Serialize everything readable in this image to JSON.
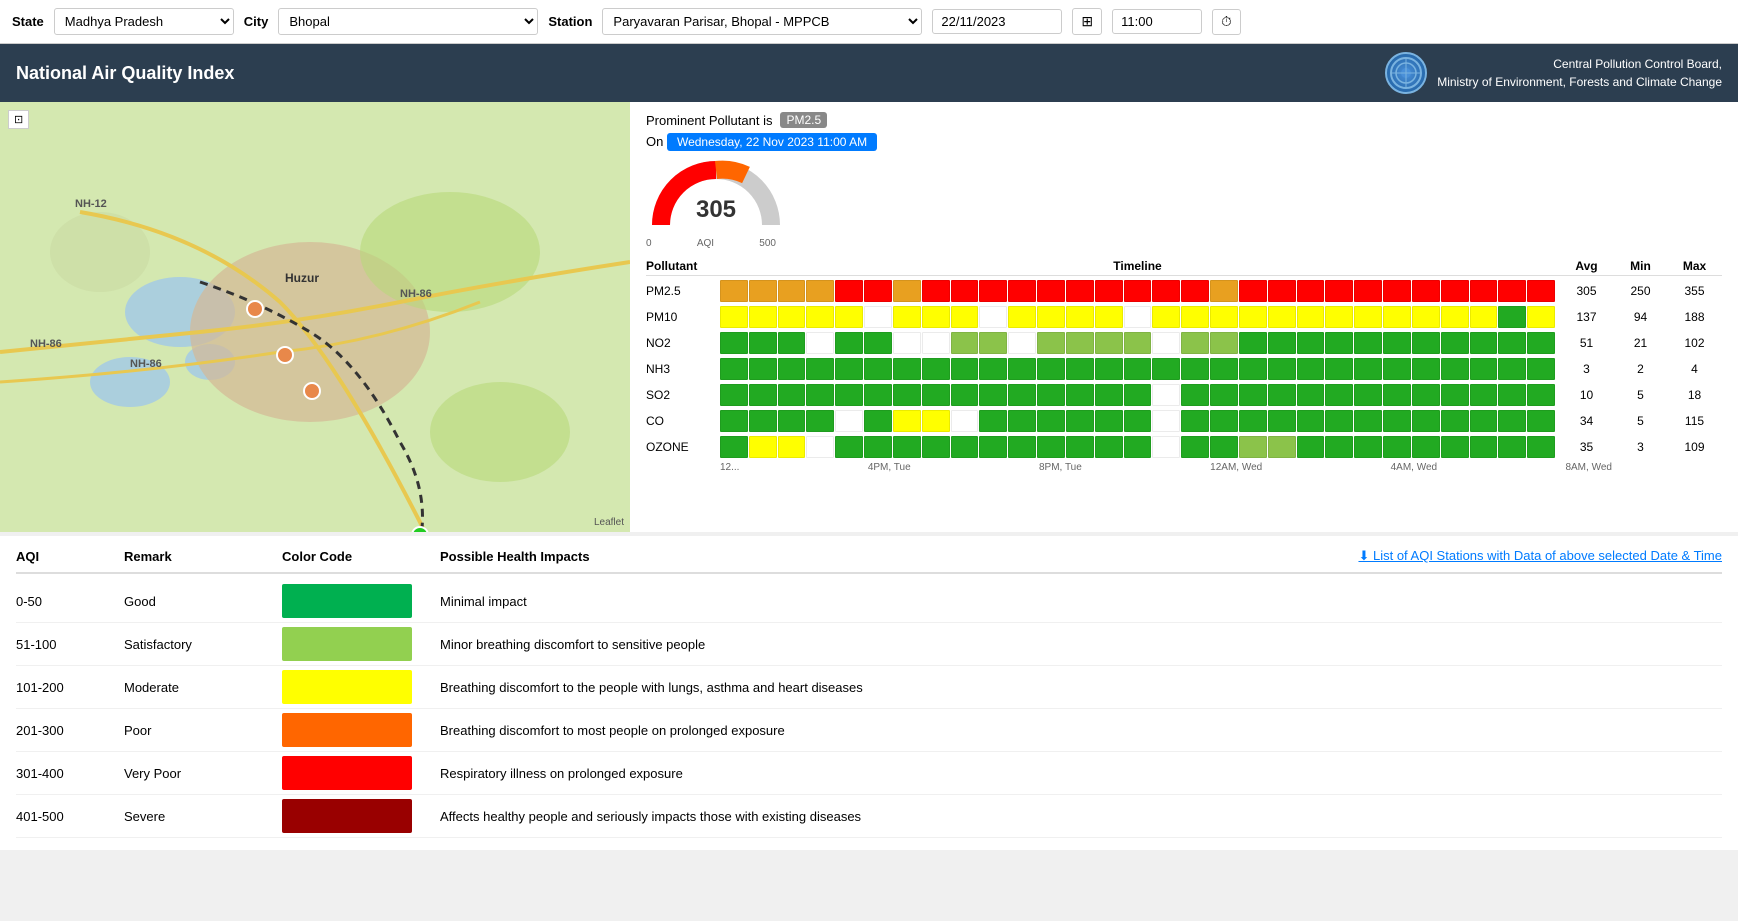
{
  "topbar": {
    "state_label": "State",
    "city_label": "City",
    "station_label": "Station",
    "state_value": "Madhya Pradesh",
    "city_value": "Bhopal",
    "station_value": "Paryavaran Parisar, Bhopal - MPPCB",
    "date_value": "22/11/2023",
    "time_value": "11:00",
    "grid_icon": "⊞",
    "clock_icon": "⏱"
  },
  "header": {
    "title": "National Air Quality Index",
    "org_line1": "Central Pollution Control Board,",
    "org_line2": "Ministry of Environment, Forests and Climate Change"
  },
  "aqi_panel": {
    "prominent_label": "Prominent Pollutant is",
    "pm25_badge": "PM2.5",
    "date_badge": "Wednesday, 22 Nov 2023 11:00 AM",
    "aqi_value": "305",
    "aqi_sublabel": "AQI",
    "gauge_min": "0",
    "gauge_mid": "500"
  },
  "pollutants": {
    "header": {
      "pollutant": "Pollutant",
      "timeline": "Timeline",
      "avg": "Avg",
      "min": "Min",
      "max": "Max"
    },
    "rows": [
      {
        "name": "PM2.5",
        "avg": "305",
        "min": "250",
        "max": "355",
        "colors": [
          "#e8a020",
          "#e8a020",
          "#e8a020",
          "#e8a020",
          "#ff0000",
          "#ff0000",
          "#e8a020",
          "#ff0000",
          "#ff0000",
          "#ff0000",
          "#ff0000",
          "#ff0000",
          "#ff0000",
          "#ff0000",
          "#ff0000",
          "#ff0000",
          "#ff0000",
          "#e8a020",
          "#ff0000",
          "#ff0000",
          "#ff0000",
          "#ff0000",
          "#ff0000",
          "#ff0000",
          "#ff0000",
          "#ff0000",
          "#ff0000",
          "#ff0000",
          "#ff0000"
        ]
      },
      {
        "name": "PM10",
        "avg": "137",
        "min": "94",
        "max": "188",
        "colors": [
          "#ffff00",
          "#ffff00",
          "#ffff00",
          "#ffff00",
          "#ffff00",
          "#ffffff",
          "#ffff00",
          "#ffff00",
          "#ffff00",
          "#ffffff",
          "#ffff00",
          "#ffff00",
          "#ffff00",
          "#ffff00",
          "#ffffff",
          "#ffff00",
          "#ffff00",
          "#ffff00",
          "#ffff00",
          "#ffff00",
          "#ffff00",
          "#ffff00",
          "#ffff00",
          "#ffff00",
          "#ffff00",
          "#ffff00",
          "#ffff00",
          "#22aa22",
          "#ffff00"
        ]
      },
      {
        "name": "NO2",
        "avg": "51",
        "min": "21",
        "max": "102",
        "colors": [
          "#22aa22",
          "#22aa22",
          "#22aa22",
          "#ffffff",
          "#22aa22",
          "#22aa22",
          "#ffffff",
          "#ffffff",
          "#8bc34a",
          "#8bc34a",
          "#ffffff",
          "#8bc34a",
          "#8bc34a",
          "#8bc34a",
          "#8bc34a",
          "#ffffff",
          "#8bc34a",
          "#8bc34a",
          "#22aa22",
          "#22aa22",
          "#22aa22",
          "#22aa22",
          "#22aa22",
          "#22aa22",
          "#22aa22",
          "#22aa22",
          "#22aa22",
          "#22aa22",
          "#22aa22"
        ]
      },
      {
        "name": "NH3",
        "avg": "3",
        "min": "2",
        "max": "4",
        "colors": [
          "#22aa22",
          "#22aa22",
          "#22aa22",
          "#22aa22",
          "#22aa22",
          "#22aa22",
          "#22aa22",
          "#22aa22",
          "#22aa22",
          "#22aa22",
          "#22aa22",
          "#22aa22",
          "#22aa22",
          "#22aa22",
          "#22aa22",
          "#22aa22",
          "#22aa22",
          "#22aa22",
          "#22aa22",
          "#22aa22",
          "#22aa22",
          "#22aa22",
          "#22aa22",
          "#22aa22",
          "#22aa22",
          "#22aa22",
          "#22aa22",
          "#22aa22",
          "#22aa22"
        ]
      },
      {
        "name": "SO2",
        "avg": "10",
        "min": "5",
        "max": "18",
        "colors": [
          "#22aa22",
          "#22aa22",
          "#22aa22",
          "#22aa22",
          "#22aa22",
          "#22aa22",
          "#22aa22",
          "#22aa22",
          "#22aa22",
          "#22aa22",
          "#22aa22",
          "#22aa22",
          "#22aa22",
          "#22aa22",
          "#22aa22",
          "#ffffff",
          "#22aa22",
          "#22aa22",
          "#22aa22",
          "#22aa22",
          "#22aa22",
          "#22aa22",
          "#22aa22",
          "#22aa22",
          "#22aa22",
          "#22aa22",
          "#22aa22",
          "#22aa22",
          "#22aa22"
        ]
      },
      {
        "name": "CO",
        "avg": "34",
        "min": "5",
        "max": "115",
        "colors": [
          "#22aa22",
          "#22aa22",
          "#22aa22",
          "#22aa22",
          "#ffffff",
          "#22aa22",
          "#ffff00",
          "#ffff00",
          "#ffffff",
          "#22aa22",
          "#22aa22",
          "#22aa22",
          "#22aa22",
          "#22aa22",
          "#22aa22",
          "#ffffff",
          "#22aa22",
          "#22aa22",
          "#22aa22",
          "#22aa22",
          "#22aa22",
          "#22aa22",
          "#22aa22",
          "#22aa22",
          "#22aa22",
          "#22aa22",
          "#22aa22",
          "#22aa22",
          "#22aa22"
        ]
      },
      {
        "name": "OZONE",
        "avg": "35",
        "min": "3",
        "max": "109",
        "colors": [
          "#22aa22",
          "#ffff00",
          "#ffff00",
          "#ffffff",
          "#22aa22",
          "#22aa22",
          "#22aa22",
          "#22aa22",
          "#22aa22",
          "#22aa22",
          "#22aa22",
          "#22aa22",
          "#22aa22",
          "#22aa22",
          "#22aa22",
          "#ffffff",
          "#22aa22",
          "#22aa22",
          "#8bc34a",
          "#8bc34a",
          "#22aa22",
          "#22aa22",
          "#22aa22",
          "#22aa22",
          "#22aa22",
          "#22aa22",
          "#22aa22",
          "#22aa22",
          "#22aa22"
        ]
      }
    ],
    "time_labels": [
      "12...",
      "4PM, Tue",
      "8PM, Tue",
      "12AM, Wed",
      "4AM, Wed",
      "8AM, Wed"
    ]
  },
  "legend": {
    "headers": [
      "AQI",
      "Remark",
      "Color Code",
      "Possible Health Impacts"
    ],
    "download_link": "⬇ List of AQI Stations with Data of above selected Date & Time",
    "rows": [
      {
        "aqi": "0-50",
        "remark": "Good",
        "color": "#00b050",
        "impact": "Minimal impact"
      },
      {
        "aqi": "51-100",
        "remark": "Satisfactory",
        "color": "#92d050",
        "impact": "Minor breathing discomfort to sensitive people"
      },
      {
        "aqi": "101-200",
        "remark": "Moderate",
        "color": "#ffff00",
        "impact": "Breathing discomfort to the people with lungs, asthma and heart diseases"
      },
      {
        "aqi": "201-300",
        "remark": "Poor",
        "color": "#ff6600",
        "impact": "Breathing discomfort to most people on prolonged exposure"
      },
      {
        "aqi": "301-400",
        "remark": "Very Poor",
        "color": "#ff0000",
        "impact": "Respiratory illness on prolonged exposure"
      },
      {
        "aqi": "401-500",
        "remark": "Severe",
        "color": "#990000",
        "impact": "Affects healthy people and seriously impacts those with existing diseases"
      }
    ]
  }
}
